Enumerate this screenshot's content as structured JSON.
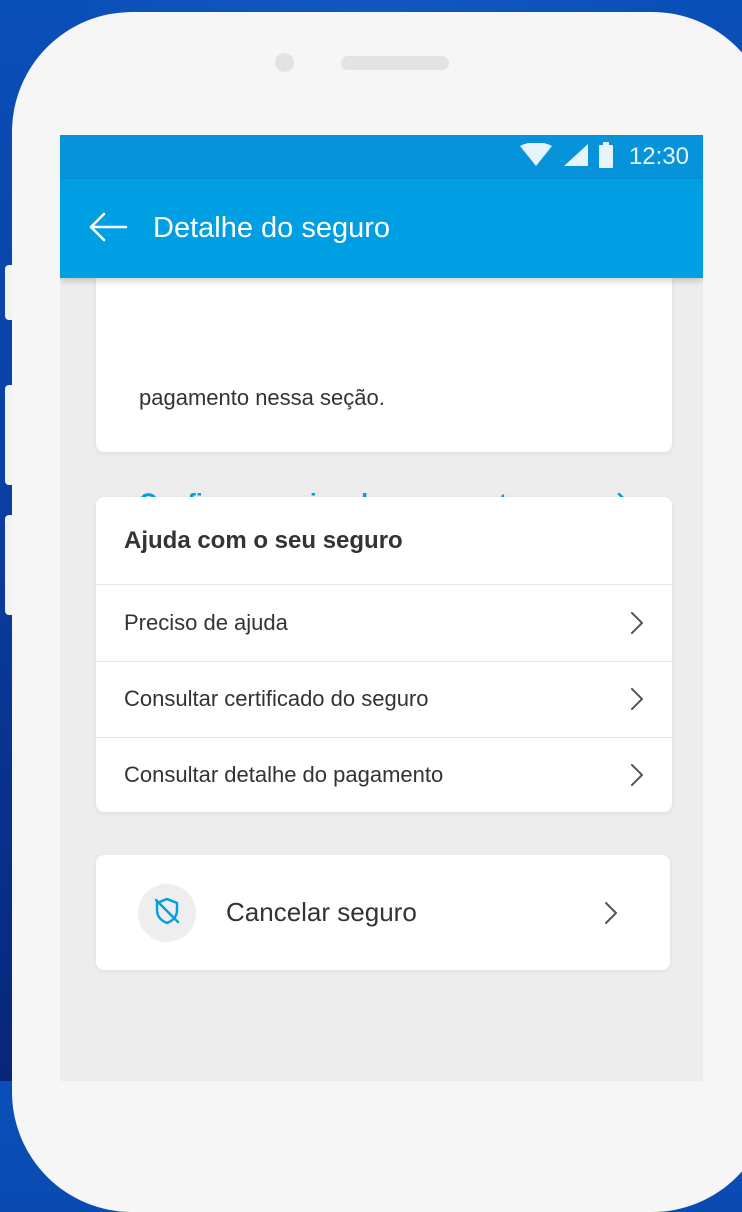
{
  "status_bar": {
    "time": "12:30",
    "icons": [
      "wifi-icon",
      "cellular-signal-icon",
      "battery-icon"
    ]
  },
  "app_bar": {
    "title": "Detalhe do seguro",
    "back_icon": "arrow-left-icon"
  },
  "payment_card": {
    "partial_text": "pagamento nessa seção.",
    "link_label": "Configurar meios de pagamento"
  },
  "help_card": {
    "title": "Ajuda com o seu seguro",
    "items": [
      {
        "label": "Preciso de ajuda"
      },
      {
        "label": "Consultar certificado do seguro"
      },
      {
        "label": "Consultar detalhe do pagamento"
      }
    ]
  },
  "cancel_card": {
    "icon": "shield-off-icon",
    "label": "Cancelar seguro"
  },
  "colors": {
    "primary": "#009ee2",
    "status_bar": "#0693d9",
    "background": "#ededed",
    "card": "#ffffff",
    "text": "#333333",
    "outer_background": "#0a3fa3"
  }
}
